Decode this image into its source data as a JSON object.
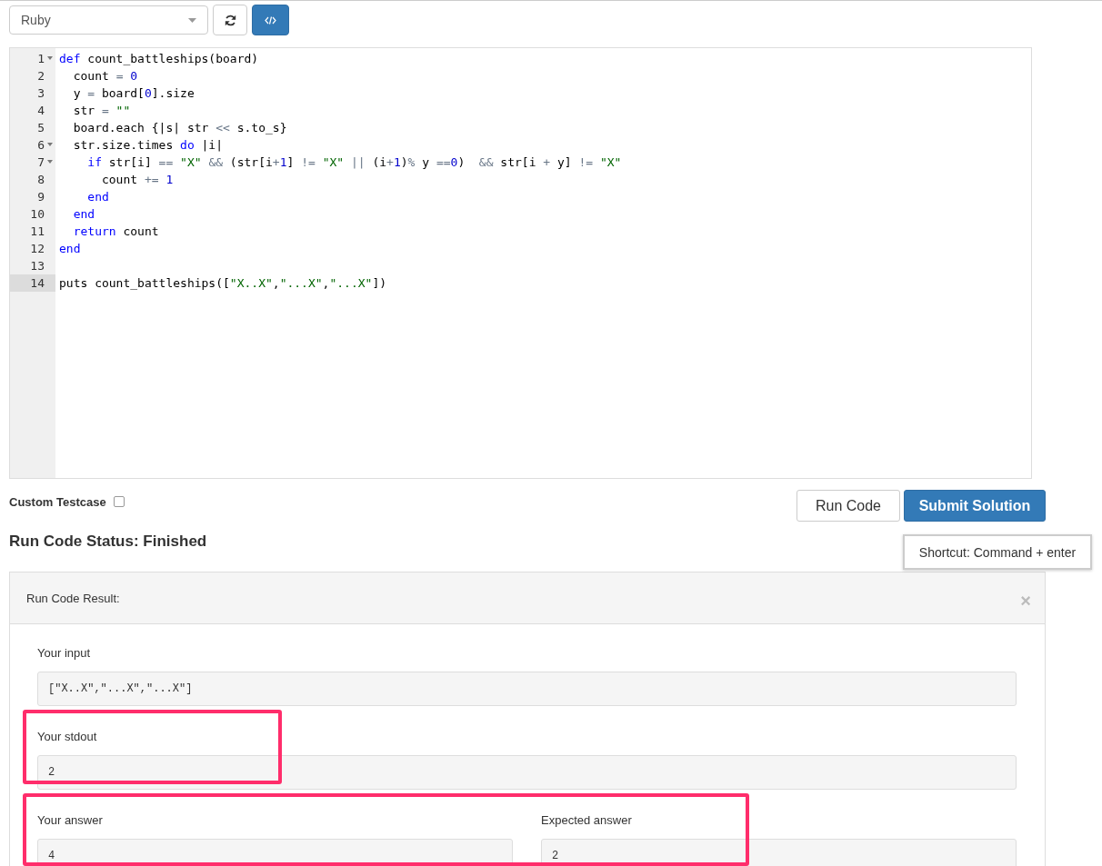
{
  "toolbar": {
    "language": "Ruby"
  },
  "editor": {
    "lines": [
      {
        "number": "1",
        "foldable": true,
        "active": false,
        "tokens": [
          {
            "kind": "keyword",
            "text": "def"
          },
          {
            "kind": "plain",
            "text": " count_battleships(board)"
          }
        ]
      },
      {
        "number": "2",
        "foldable": false,
        "active": false,
        "tokens": [
          {
            "kind": "plain",
            "text": "  count "
          },
          {
            "kind": "operator",
            "text": "="
          },
          {
            "kind": "number",
            "text": " 0"
          }
        ]
      },
      {
        "number": "3",
        "foldable": false,
        "active": false,
        "tokens": [
          {
            "kind": "plain",
            "text": "  y "
          },
          {
            "kind": "operator",
            "text": "="
          },
          {
            "kind": "plain",
            "text": " board["
          },
          {
            "kind": "number",
            "text": "0"
          },
          {
            "kind": "plain",
            "text": "].size"
          }
        ]
      },
      {
        "number": "4",
        "foldable": false,
        "active": false,
        "tokens": [
          {
            "kind": "plain",
            "text": "  str "
          },
          {
            "kind": "operator",
            "text": "="
          },
          {
            "kind": "string",
            "text": " \"\""
          }
        ]
      },
      {
        "number": "5",
        "foldable": false,
        "active": false,
        "tokens": [
          {
            "kind": "plain",
            "text": "  board.each {|s| str "
          },
          {
            "kind": "operator",
            "text": "<<"
          },
          {
            "kind": "plain",
            "text": " s.to_s}"
          }
        ]
      },
      {
        "number": "6",
        "foldable": true,
        "active": false,
        "tokens": [
          {
            "kind": "plain",
            "text": "  str.size.times "
          },
          {
            "kind": "keyword",
            "text": "do"
          },
          {
            "kind": "plain",
            "text": " |i|"
          }
        ]
      },
      {
        "number": "7",
        "foldable": true,
        "active": false,
        "tokens": [
          {
            "kind": "keyword",
            "text": "    if"
          },
          {
            "kind": "plain",
            "text": " str[i] "
          },
          {
            "kind": "operator",
            "text": "=="
          },
          {
            "kind": "string",
            "text": " \"X\""
          },
          {
            "kind": "operator",
            "text": " &&"
          },
          {
            "kind": "plain",
            "text": " (str[i"
          },
          {
            "kind": "operator",
            "text": "+"
          },
          {
            "kind": "number",
            "text": "1"
          },
          {
            "kind": "plain",
            "text": "] "
          },
          {
            "kind": "operator",
            "text": "!="
          },
          {
            "kind": "string",
            "text": " \"X\""
          },
          {
            "kind": "operator",
            "text": " ||"
          },
          {
            "kind": "plain",
            "text": " (i"
          },
          {
            "kind": "operator",
            "text": "+"
          },
          {
            "kind": "number",
            "text": "1"
          },
          {
            "kind": "plain",
            "text": ")"
          },
          {
            "kind": "operator",
            "text": "%"
          },
          {
            "kind": "plain",
            "text": " y "
          },
          {
            "kind": "operator",
            "text": "=="
          },
          {
            "kind": "number",
            "text": "0"
          },
          {
            "kind": "plain",
            "text": ")  "
          },
          {
            "kind": "operator",
            "text": "&&"
          },
          {
            "kind": "plain",
            "text": " str[i "
          },
          {
            "kind": "operator",
            "text": "+"
          },
          {
            "kind": "plain",
            "text": " y] "
          },
          {
            "kind": "operator",
            "text": "!="
          },
          {
            "kind": "string",
            "text": " \"X\""
          }
        ]
      },
      {
        "number": "8",
        "foldable": false,
        "active": false,
        "tokens": [
          {
            "kind": "plain",
            "text": "      count "
          },
          {
            "kind": "operator",
            "text": "+="
          },
          {
            "kind": "number",
            "text": " 1"
          }
        ]
      },
      {
        "number": "9",
        "foldable": false,
        "active": false,
        "tokens": [
          {
            "kind": "keyword",
            "text": "    end"
          }
        ]
      },
      {
        "number": "10",
        "foldable": false,
        "active": false,
        "tokens": [
          {
            "kind": "keyword",
            "text": "  end"
          }
        ]
      },
      {
        "number": "11",
        "foldable": false,
        "active": false,
        "tokens": [
          {
            "kind": "keyword",
            "text": "  return"
          },
          {
            "kind": "plain",
            "text": " count"
          }
        ]
      },
      {
        "number": "12",
        "foldable": false,
        "active": false,
        "tokens": [
          {
            "kind": "keyword",
            "text": "end"
          }
        ]
      },
      {
        "number": "13",
        "foldable": false,
        "active": false
      },
      {
        "number": "14",
        "foldable": false,
        "active": true,
        "tokens": [
          {
            "kind": "plain",
            "text": "puts count_battleships(["
          },
          {
            "kind": "string",
            "text": "\"X..X\""
          },
          {
            "kind": "plain",
            "text": ","
          },
          {
            "kind": "string",
            "text": "\"...X\""
          },
          {
            "kind": "plain",
            "text": ","
          },
          {
            "kind": "string",
            "text": "\"...X\""
          },
          {
            "kind": "plain",
            "text": "])"
          }
        ]
      }
    ]
  },
  "custom_testcase": {
    "label": "Custom Testcase",
    "checked": false
  },
  "buttons": {
    "run": "Run Code",
    "submit": "Submit Solution"
  },
  "tooltip": "Shortcut: Command + enter",
  "status": "Run Code Status: Finished",
  "result": {
    "title": "Run Code Result:",
    "close": "×",
    "input": {
      "label": "Your input",
      "value": "[\"X..X\",\"...X\",\"...X\"]"
    },
    "stdout": {
      "label": "Your stdout",
      "value": "2"
    },
    "answer": {
      "label": "Your answer",
      "value": "4"
    },
    "expected": {
      "label": "Expected answer",
      "value": "2"
    }
  }
}
